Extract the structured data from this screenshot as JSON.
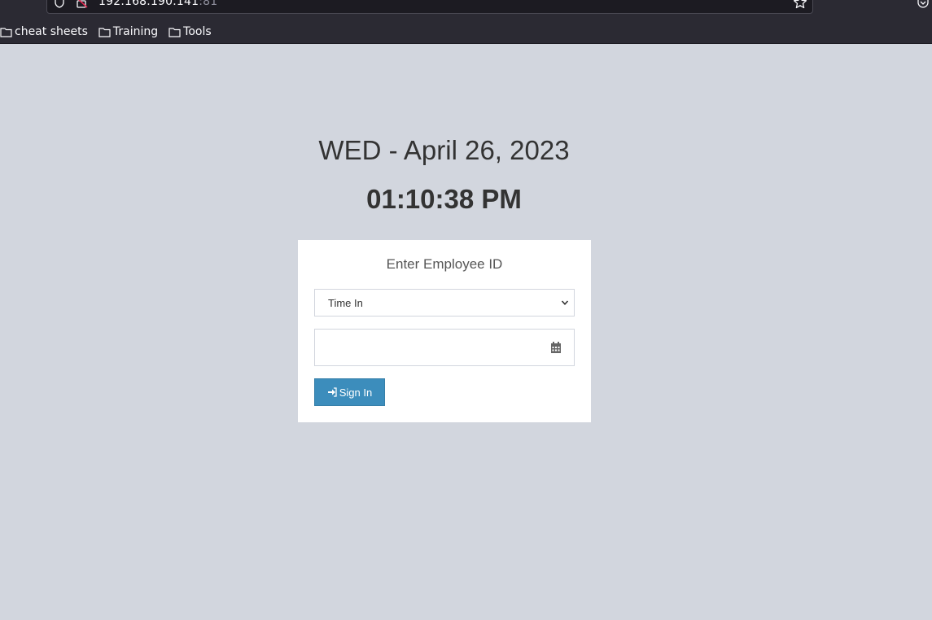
{
  "browser": {
    "url_host": "192.168.190.141",
    "url_port": ":81",
    "bookmarks": [
      {
        "label": "cheat sheets",
        "icon": "folder-icon"
      },
      {
        "label": "Training",
        "icon": "folder-icon"
      },
      {
        "label": "Tools",
        "icon": "folder-icon"
      }
    ]
  },
  "page": {
    "date": "WED - April 26, 2023",
    "time": "01:10:38 PM"
  },
  "form": {
    "title": "Enter Employee ID",
    "status_selected": "Time In",
    "employee_id_value": "",
    "sign_in_label": "Sign In"
  },
  "colors": {
    "background": "#d2d6de",
    "button": "#3c8dbc"
  }
}
